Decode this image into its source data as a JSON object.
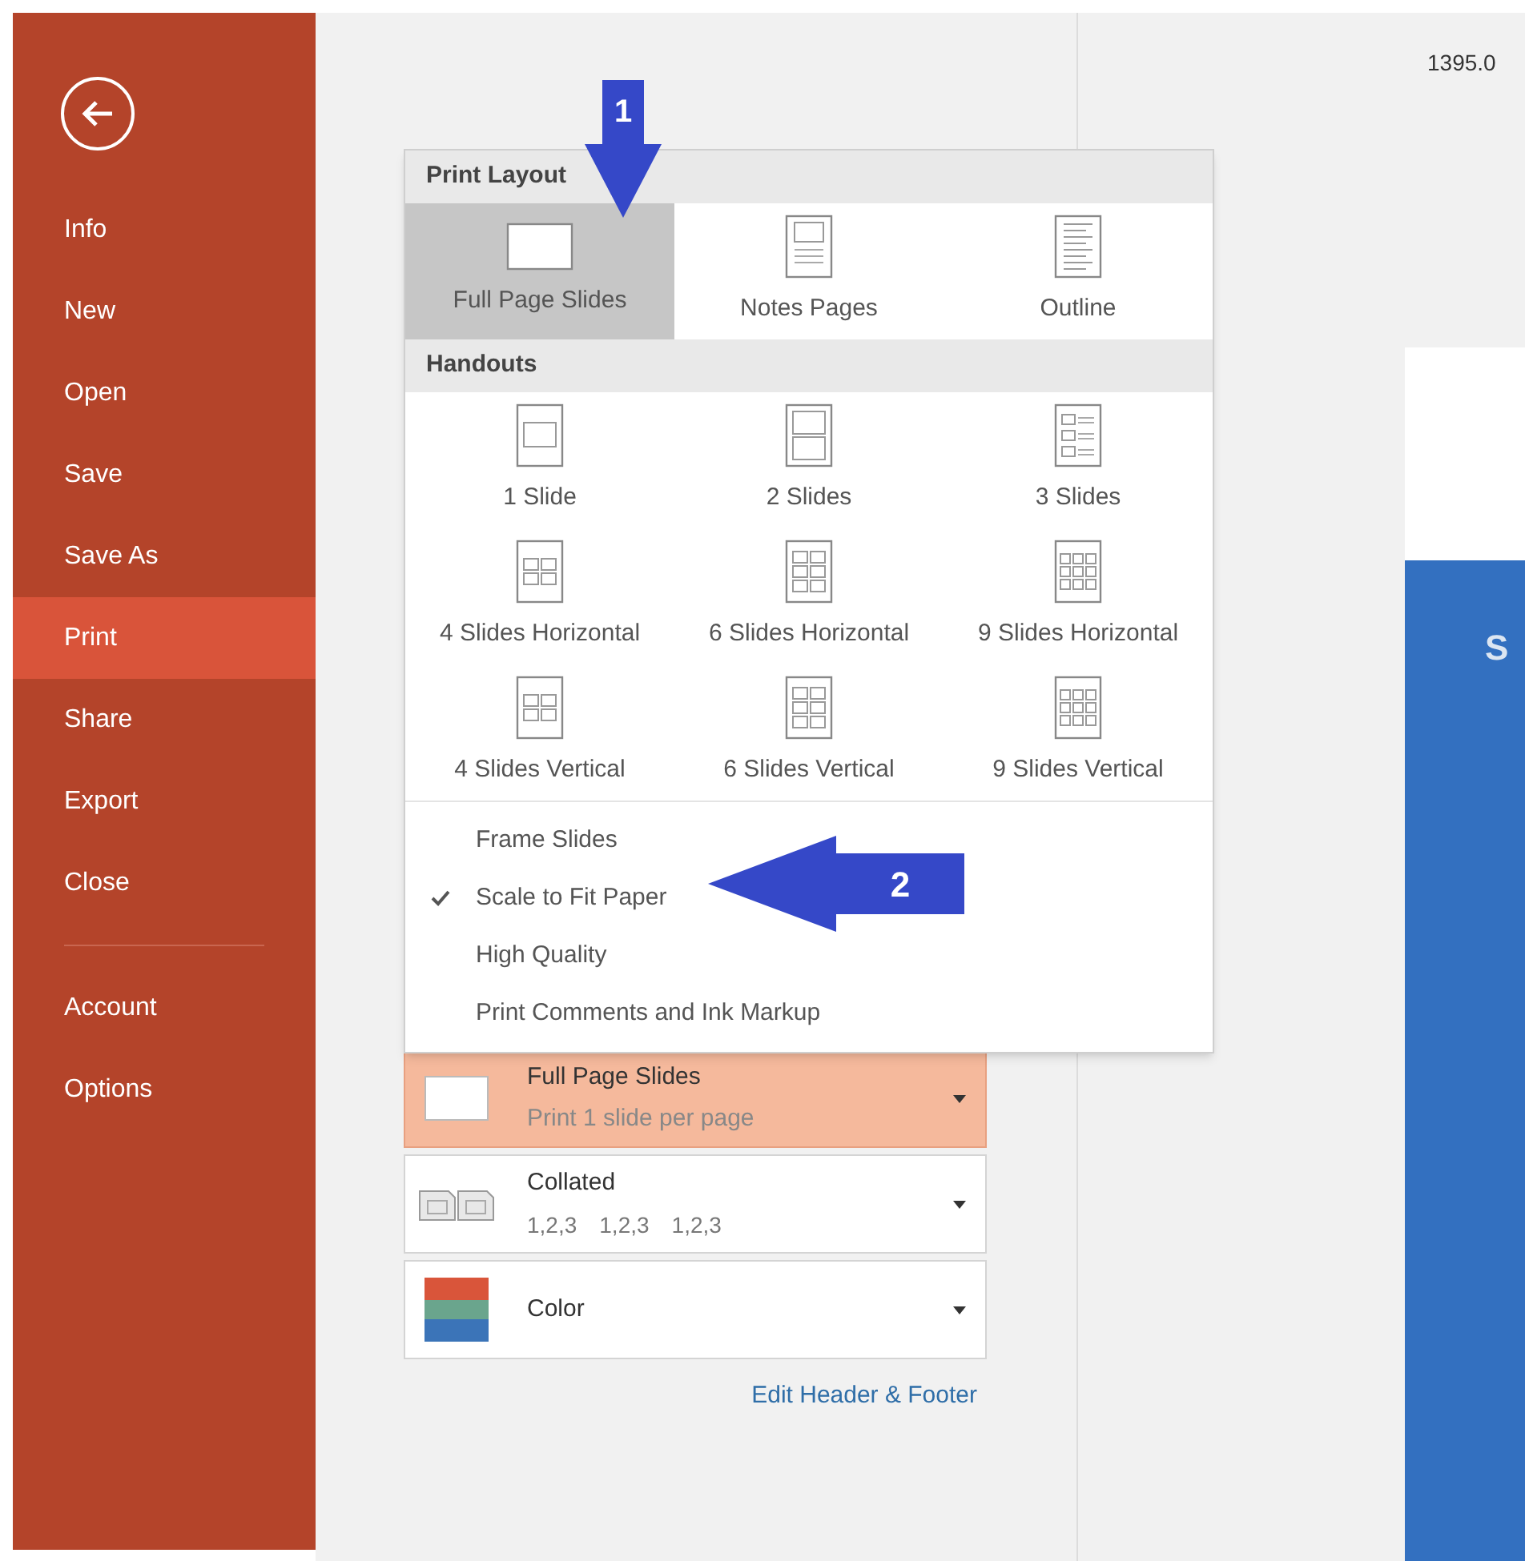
{
  "sidebar": {
    "items": [
      {
        "label": "Info",
        "selected": false
      },
      {
        "label": "New",
        "selected": false
      },
      {
        "label": "Open",
        "selected": false
      },
      {
        "label": "Save",
        "selected": false
      },
      {
        "label": "Save As",
        "selected": false
      },
      {
        "label": "Print",
        "selected": true
      },
      {
        "label": "Share",
        "selected": false
      },
      {
        "label": "Export",
        "selected": false
      },
      {
        "label": "Close",
        "selected": false
      }
    ],
    "footer_items": [
      {
        "label": "Account",
        "selected": false
      },
      {
        "label": "Options",
        "selected": false
      }
    ]
  },
  "layout_menu": {
    "sections": [
      {
        "title": "Print Layout",
        "items": [
          {
            "label": "Full Page Slides",
            "kind": "full",
            "selected": true
          },
          {
            "label": "Notes Pages",
            "kind": "notes",
            "selected": false
          },
          {
            "label": "Outline",
            "kind": "outline",
            "selected": false
          }
        ]
      },
      {
        "title": "Handouts",
        "items": [
          {
            "label": "1 Slide",
            "kind": "h1",
            "selected": false
          },
          {
            "label": "2 Slides",
            "kind": "h2",
            "selected": false
          },
          {
            "label": "3 Slides",
            "kind": "h3",
            "selected": false
          },
          {
            "label": "4 Slides Horizontal",
            "kind": "h4",
            "selected": false
          },
          {
            "label": "6 Slides Horizontal",
            "kind": "h6",
            "selected": false
          },
          {
            "label": "9 Slides Horizontal",
            "kind": "h9",
            "selected": false
          },
          {
            "label": "4 Slides Vertical",
            "kind": "h4",
            "selected": false
          },
          {
            "label": "6 Slides Vertical",
            "kind": "h6",
            "selected": false
          },
          {
            "label": "9 Slides Vertical",
            "kind": "h9",
            "selected": false
          }
        ]
      }
    ],
    "options": [
      {
        "label": "Frame Slides",
        "checked": false
      },
      {
        "label": "Scale to Fit Paper",
        "checked": true
      },
      {
        "label": "High Quality",
        "checked": false
      },
      {
        "label": "Print Comments and Ink Markup",
        "checked": false
      }
    ]
  },
  "settings": [
    {
      "kind": "layout",
      "title": "Full Page Slides",
      "subtitle": "Print 1 slide per page",
      "highlighted": true
    },
    {
      "kind": "collate",
      "title": "Collated",
      "subtitle_parts": [
        "1,2,3",
        "1,2,3",
        "1,2,3"
      ],
      "highlighted": false
    },
    {
      "kind": "color",
      "title": "Color",
      "highlighted": false
    }
  ],
  "edit_link": "Edit Header & Footer",
  "preview": {
    "date": "1395.0",
    "slide_title": "S"
  },
  "annotations": [
    {
      "number": "1",
      "kind": "down"
    },
    {
      "number": "2",
      "kind": "left"
    }
  ]
}
